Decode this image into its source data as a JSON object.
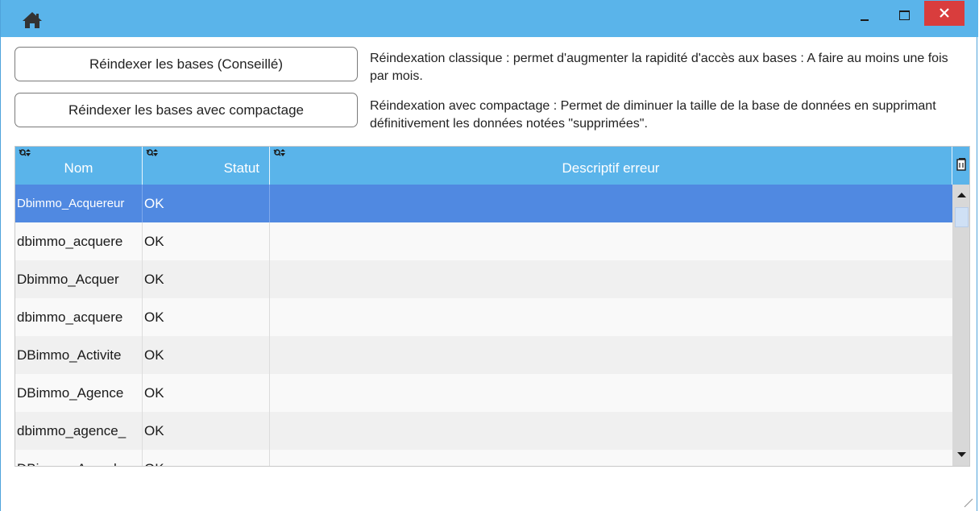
{
  "buttons": {
    "reindex_classic": "Réindexer les bases (Conseillé)",
    "reindex_compact": "Réindexer les bases avec compactage"
  },
  "descriptions": {
    "classic": "Réindexation classique : permet d'augmenter la rapidité d'accès aux bases : A faire au moins une fois par mois.",
    "compact": "Réindexation avec compactage : Permet de diminuer la taille de la base de données en supprimant définitivement les données notées \"supprimées\"."
  },
  "table": {
    "columns": {
      "name": "Nom",
      "status": "Statut",
      "error": "Descriptif erreur"
    },
    "rows": [
      {
        "name": "Dbimmo_Acquereur",
        "status": "OK",
        "error": ""
      },
      {
        "name": "dbimmo_acquere",
        "status": "OK",
        "error": ""
      },
      {
        "name": "Dbimmo_Acquer",
        "status": "OK",
        "error": ""
      },
      {
        "name": "dbimmo_acquere",
        "status": "OK",
        "error": ""
      },
      {
        "name": "DBimmo_Activite",
        "status": "OK",
        "error": ""
      },
      {
        "name": "DBimmo_Agence",
        "status": "OK",
        "error": ""
      },
      {
        "name": "dbimmo_agence_",
        "status": "OK",
        "error": ""
      },
      {
        "name": "DBimmo_Agend",
        "status": "OK",
        "error": ""
      }
    ]
  },
  "icons": {
    "home": "home-icon",
    "minimize": "minimize-icon",
    "maximize": "maximize-icon",
    "close": "close-icon",
    "sort": "sort-search-icon",
    "column_config": "column-config-icon"
  },
  "colors": {
    "titlebar": "#5ab4ea",
    "close_button": "#d93d3d",
    "selected_row": "#5089e1"
  }
}
